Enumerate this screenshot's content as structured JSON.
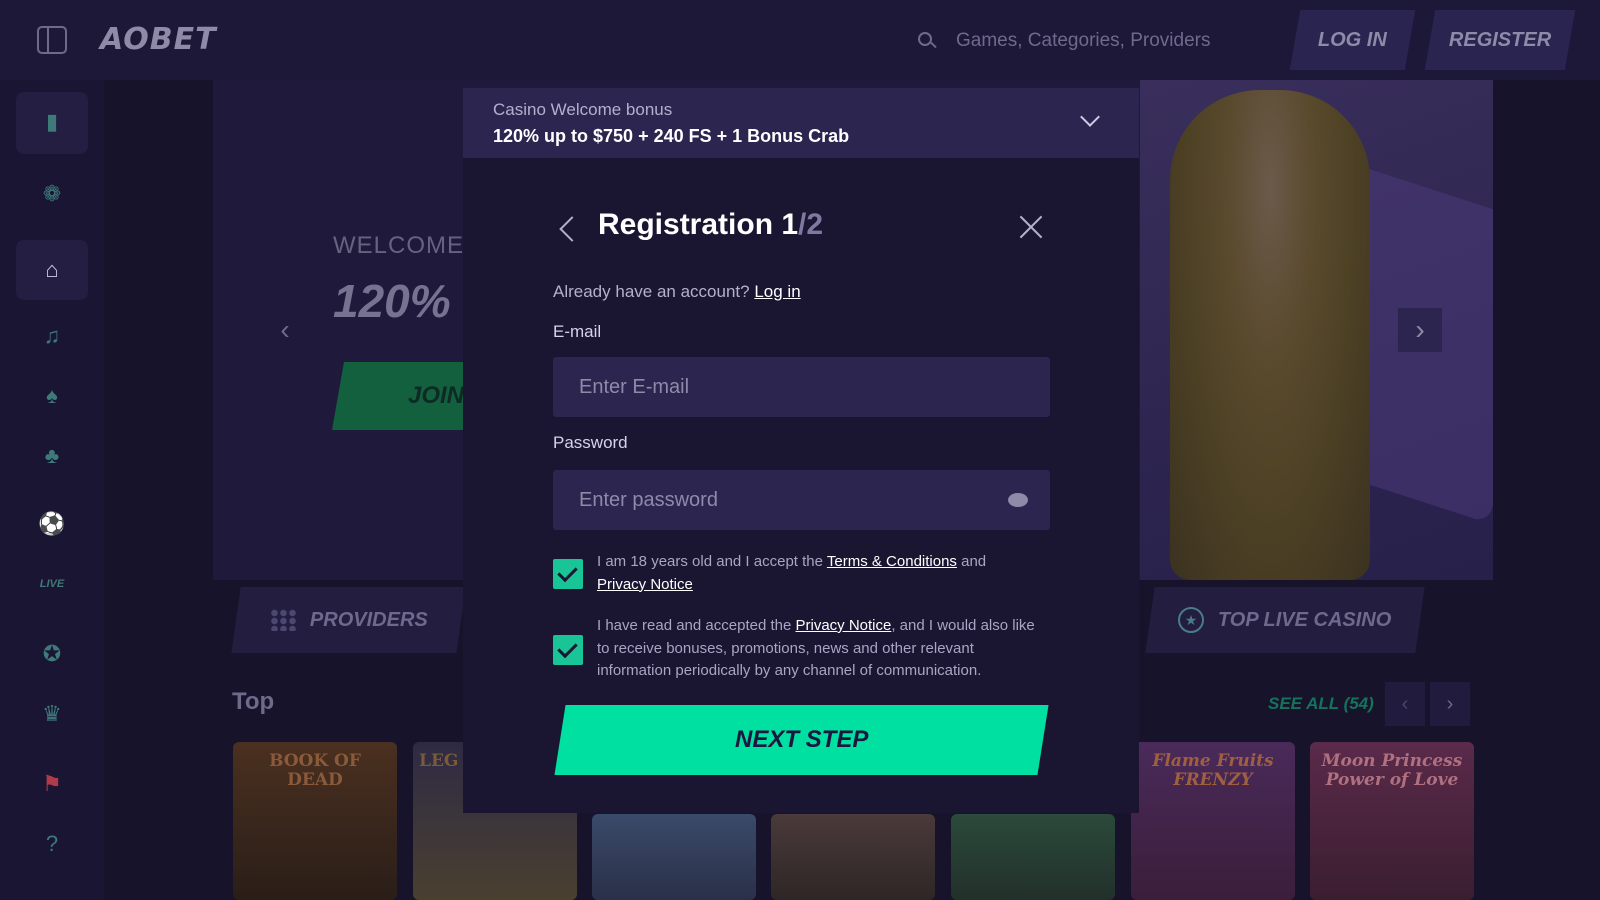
{
  "header": {
    "logo": "AOBET",
    "search_placeholder": "Games, Categories, Providers",
    "login_label": "LOG IN",
    "register_label": "REGISTER"
  },
  "sidebar": {
    "items": [
      {
        "name": "promo-drink-icon"
      },
      {
        "name": "promotions-icon"
      },
      {
        "name": "home-icon"
      },
      {
        "name": "slots-icon"
      },
      {
        "name": "cards-icon"
      },
      {
        "name": "clover-icon"
      },
      {
        "name": "sports-icon"
      },
      {
        "name": "live-icon",
        "label": "LIVE"
      },
      {
        "name": "vip-icon"
      },
      {
        "name": "trophy-icon"
      },
      {
        "name": "canada-flag-icon"
      },
      {
        "name": "help-icon"
      }
    ]
  },
  "hero": {
    "welcome": "WELCOME",
    "amount": "120%",
    "join_label": "JOIN"
  },
  "tabs": {
    "providers": "PROVIDERS",
    "top_live_casino": "TOP LIVE CASINO"
  },
  "top_section": {
    "title": "Top",
    "see_all": "SEE ALL (54)"
  },
  "games": [
    {
      "title": "BOOK OF DEAD",
      "color": "#5a3a20"
    },
    {
      "title": "LEG",
      "color": "#4a3a5a"
    },
    {
      "title": "",
      "color": "#3a4a6a"
    },
    {
      "title": "",
      "color": "#4a3a3a"
    },
    {
      "title": "",
      "color": "#2a4a3a"
    },
    {
      "title": "Flame Fruits FRENZY",
      "color": "#5a2a5a"
    },
    {
      "title": "Moon Princess Power of Love",
      "color": "#6a2a4a"
    }
  ],
  "modal": {
    "bonus_label": "Casino Welcome bonus",
    "bonus_value": "120% up to $750 + 240 FS + 1 Bonus Crab",
    "title_main": "Registration 1",
    "title_of": "/2",
    "already_text": "Already have an account?",
    "login_link": "Log in",
    "email_label": "E-mail",
    "email_placeholder": "Enter E-mail",
    "password_label": "Password",
    "password_placeholder": "Enter password",
    "terms_prefix": "I am 18 years old and I accept the",
    "terms_link": "Terms & Conditions",
    "terms_and": "and",
    "privacy_link": "Privacy Notice",
    "marketing_prefix": "I have read and accepted the",
    "marketing_privacy_link": "Privacy Notice",
    "marketing_suffix": ", and I would also like to receive bonuses, promotions, news and other relevant information periodically by any channel of communication.",
    "next_step": "NEXT STEP"
  },
  "colors": {
    "accent": "#00e0a0",
    "background": "#17132b",
    "modal_bg": "#1a1530"
  }
}
